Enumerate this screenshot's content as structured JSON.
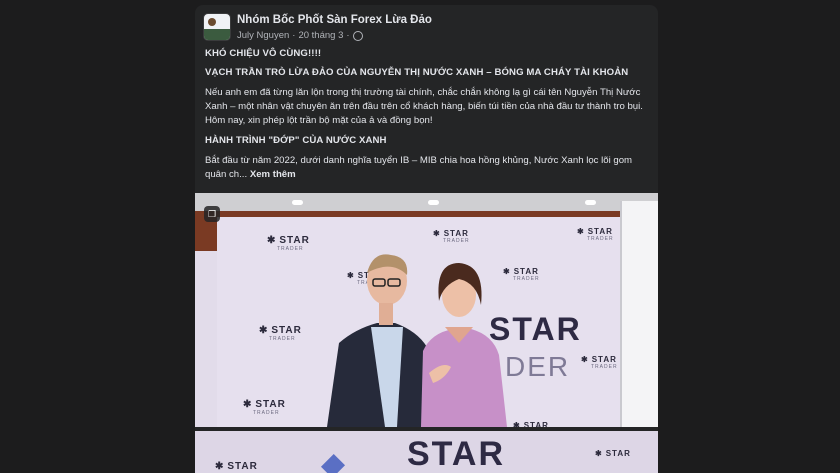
{
  "post": {
    "group_name": "Nhóm Bốc Phốt Sàn Forex Lừa Đảo",
    "author": "July Nguyen",
    "separator": "·",
    "date": "20 tháng 3",
    "privacy_icon": "globe-icon"
  },
  "content": {
    "line1": "KHÓ CHIỆU VÔ CÙNG!!!!",
    "line2": "VẠCH TRẦN TRÒ LỪA ĐẢO CỦA NGUYỄN THỊ NƯỚC XANH – BÓNG MA CHÁY TÀI KHOẢN",
    "paragraph1": "Nếu anh em đã từng lăn lộn trong thị trường tài chính, chắc chắn không lạ gì cái tên Nguyễn Thị Nước Xanh – một nhân vật chuyên ăn trên đầu trên cổ khách hàng, biến túi tiền của nhà đầu tư thành tro bụi. Hôm nay, xin phép lột trần bộ mặt của ả và đồng bọn!",
    "heading2": "HÀNH TRÌNH \"ĐỚP\" CỦA NƯỚC XANH",
    "paragraph2": "Bắt đầu từ năm 2022, dưới danh nghĩa tuyển IB – MIB chia hoa hồng khủng, Nước Xanh lọc lõi gom quân ch...",
    "see_more": "Xem thêm"
  },
  "photos": {
    "logo_word": "STAR",
    "logo_sub": "TRADER",
    "big_logo_tail": "DER",
    "gallery_icon": "stack-icon"
  },
  "colors": {
    "background": "#1c1c1d",
    "card": "#242526",
    "text_primary": "#e4e6eb",
    "text_secondary": "#b0b3b8"
  }
}
